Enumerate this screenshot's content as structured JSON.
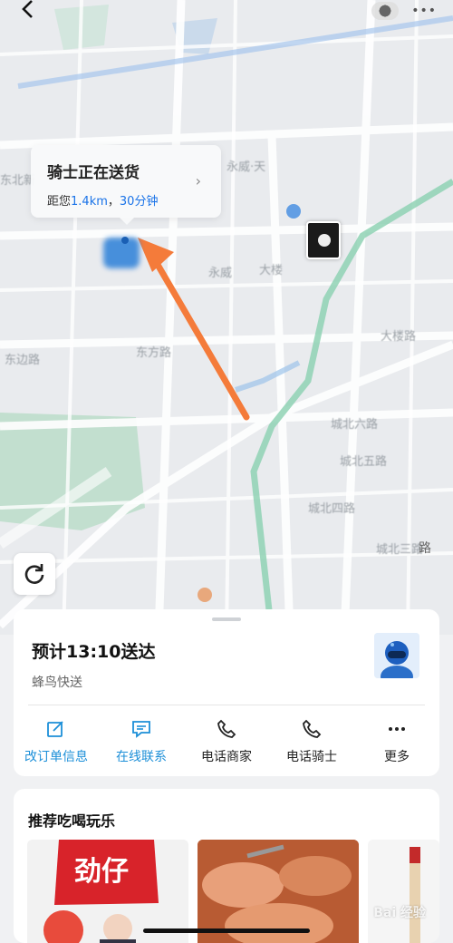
{
  "map": {
    "labels": [
      "东北新",
      "永威·天",
      "大楼",
      "东方路",
      "东边路",
      "大楼路",
      "永威",
      "城北六路",
      "城北五路",
      "城北四路",
      "城北三路",
      "路",
      "东"
    ],
    "bubble": {
      "title": "骑士正在送货",
      "distance_prefix": "距您",
      "distance": "1.4km",
      "separator": "，",
      "time": "30分钟"
    }
  },
  "delivery": {
    "eta": "预计13:10送达",
    "carrier": "蜂鸟快送",
    "actions": [
      {
        "label": "改订单信息",
        "icon": "edit-icon"
      },
      {
        "label": "在线联系",
        "icon": "chat-icon"
      },
      {
        "label": "电话商家",
        "icon": "phone-icon"
      },
      {
        "label": "电话骑士",
        "icon": "phone-icon"
      },
      {
        "label": "更多",
        "icon": "more-icon"
      }
    ]
  },
  "recommend": {
    "title": "推荐吃喝玩乐",
    "items": [
      {
        "label": "劲仔"
      }
    ]
  },
  "watermark": "Bai 经验",
  "colors": {
    "accent": "#1c8fd8",
    "arrow": "#f47b3a",
    "green_route": "#8fd2b4"
  }
}
